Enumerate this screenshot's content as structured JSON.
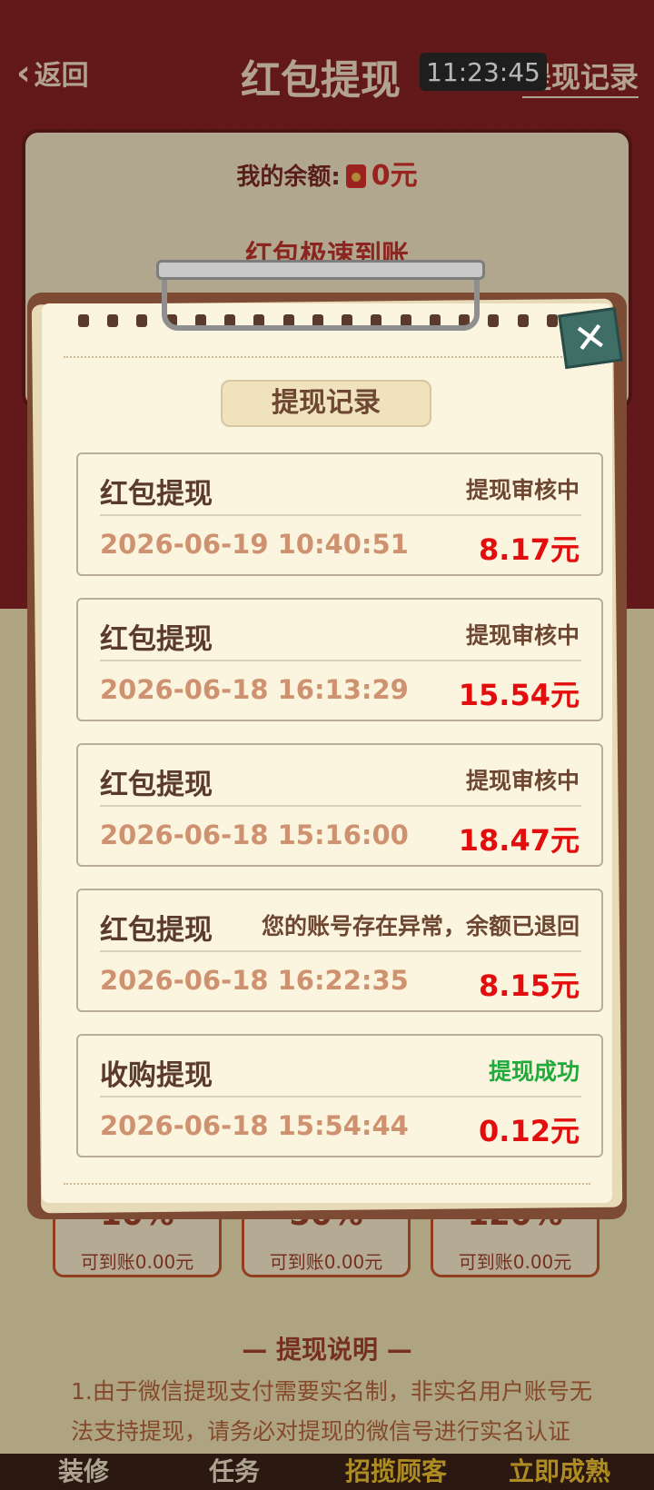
{
  "header": {
    "back_label": "返回",
    "title": "红包提现",
    "history_link": "提现记录",
    "status_time": "11:23:45"
  },
  "balance": {
    "label": "我的余额:",
    "amount": "0元",
    "fast_label": "红包极速到账"
  },
  "tiers": [
    {
      "percent": "10%",
      "sub": "可到账0.00元"
    },
    {
      "percent": "50%",
      "sub": "可到账0.00元"
    },
    {
      "percent": "120%",
      "sub": "可到账0.00元"
    }
  ],
  "notes": {
    "heading": "— 提现说明 —",
    "text": "1.由于微信提现支付需要实名制，非实名用户账号无法支持提现，请务必对提现的微信号进行实名认证"
  },
  "bottom_nav": {
    "items": [
      "装修",
      "任务",
      "招揽顾客",
      "立即成熟"
    ]
  },
  "modal": {
    "title": "提现记录",
    "close_icon": "close-icon",
    "records": [
      {
        "type": "红包提现",
        "status": "提现审核中",
        "date": "2026-06-19 10:40:51",
        "amount": "8.17元"
      },
      {
        "type": "红包提现",
        "status": "提现审核中",
        "date": "2026-06-18 16:13:29",
        "amount": "15.54元"
      },
      {
        "type": "红包提现",
        "status": "提现审核中",
        "date": "2026-06-18 15:16:00",
        "amount": "18.47元"
      },
      {
        "type": "红包提现",
        "status": "您的账号存在异常，余额已退回",
        "date": "2026-06-18 16:22:35",
        "amount": "8.15元"
      },
      {
        "type": "收购提现",
        "status": "提现成功",
        "date": "2026-06-18 15:54:44",
        "amount": "0.12元"
      }
    ]
  },
  "colors": {
    "header_bg": "#8a2323",
    "page_bg": "#f3e4b4",
    "amount_red": "#e30d0d",
    "success_green": "#1fab3c",
    "status_brown": "#6e4732",
    "date_tan": "#cf9270"
  }
}
